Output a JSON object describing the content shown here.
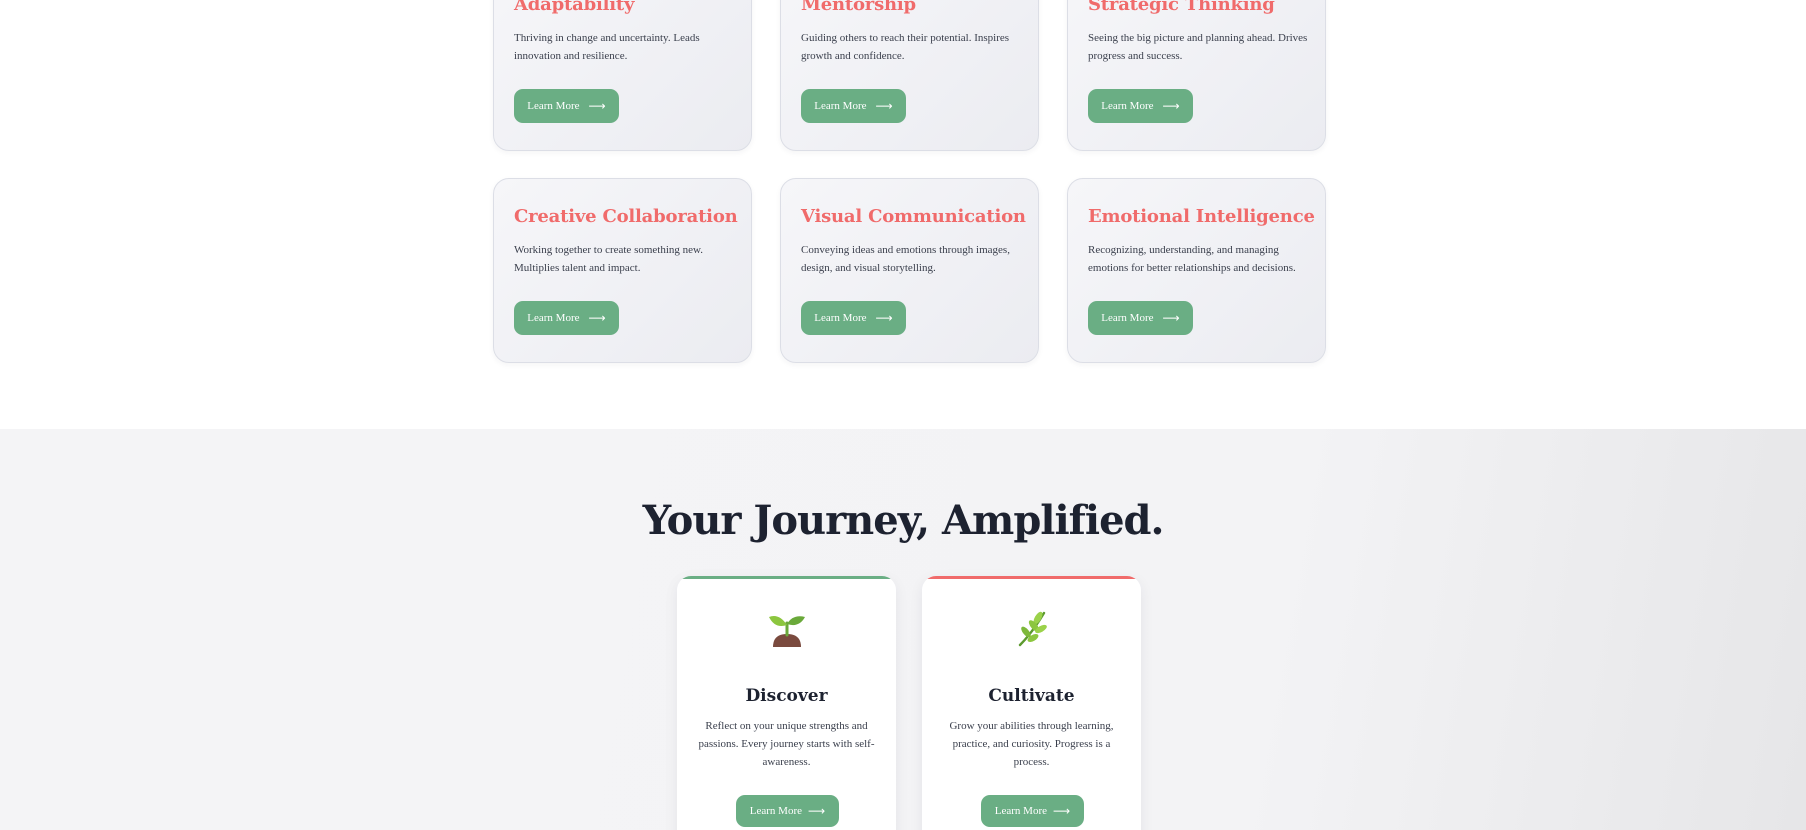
{
  "skill_cards": [
    {
      "title": "Adaptability",
      "description": "Thriving in change and uncertainty. Leads innovation and resilience.",
      "button_label": "Learn More",
      "button_icon": "arrow-right-icon"
    },
    {
      "title": "Mentorship",
      "description": "Guiding others to reach their potential. Inspires growth and confidence.",
      "button_label": "Learn More",
      "button_icon": "arrow-right-icon"
    },
    {
      "title": "Strategic Thinking",
      "description": "Seeing the big picture and planning ahead. Drives progress and success.",
      "button_label": "Learn More",
      "button_icon": "arrow-right-icon"
    },
    {
      "title": "Creative Collaboration",
      "description": "Working together to create something new. Multiplies talent and impact.",
      "button_label": "Learn More",
      "button_icon": "arrow-right-icon"
    },
    {
      "title": "Visual Communication",
      "description": "Conveying ideas and emotions through images, design, and visual storytelling.",
      "button_label": "Learn More",
      "button_icon": "arrow-right-icon"
    },
    {
      "title": "Emotional Intelligence",
      "description": "Recognizing, understanding, and managing emotions for better relationships and decisions.",
      "button_label": "Learn More",
      "button_icon": "arrow-right-icon"
    }
  ],
  "journey": {
    "heading": "Your Journey, Amplified.",
    "cards": [
      {
        "icon": "seedling-icon",
        "title": "Discover",
        "description": "Reflect on your unique strengths and passions. Every journey starts with self-awareness.",
        "button_label": "Learn More",
        "accent": "#6aae84"
      },
      {
        "icon": "herb-icon",
        "title": "Cultivate",
        "description": "Grow your abilities through learning, practice, and curiosity. Progress is a process.",
        "button_label": "Learn More",
        "accent": "#f06b6b"
      }
    ]
  },
  "colors": {
    "title_accent": "#f06b6b",
    "button_green": "#6aae84",
    "heading_dark": "#1d2230"
  }
}
